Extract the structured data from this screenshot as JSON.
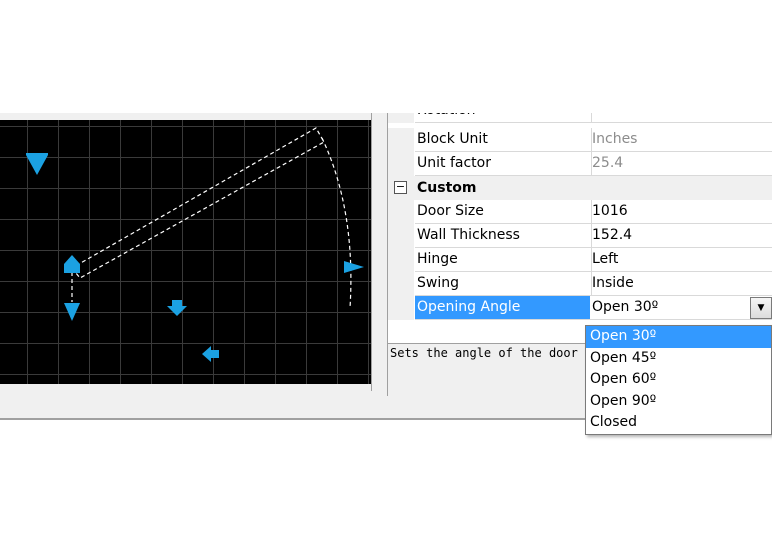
{
  "properties": {
    "partial_row": "Rotation",
    "rows": [
      {
        "name": "Block Unit",
        "value": "Inches"
      },
      {
        "name": "Unit factor",
        "value": "25.4"
      }
    ],
    "category": {
      "label": "Custom",
      "toggle": "−"
    },
    "custom_rows": [
      {
        "name": "Door Size",
        "value": "1016"
      },
      {
        "name": "Wall Thickness",
        "value": "152.4"
      },
      {
        "name": "Hinge",
        "value": "Left"
      },
      {
        "name": "Swing",
        "value": "Inside"
      }
    ],
    "selected_row": {
      "name": "Opening Angle",
      "value": "Open 30º"
    }
  },
  "description": "Sets the angle of the door",
  "dropdown": {
    "options": [
      "Open 30º",
      "Open 45º",
      "Open 60º",
      "Open 90º",
      "Closed"
    ],
    "selected_index": 0
  },
  "colors": {
    "grip": "#1ba1e2",
    "selection": "#3399ff",
    "canvas": "#000000"
  },
  "icons": {
    "dropdown_arrow": "chevron-down-icon",
    "collapse": "minus-box-icon"
  }
}
